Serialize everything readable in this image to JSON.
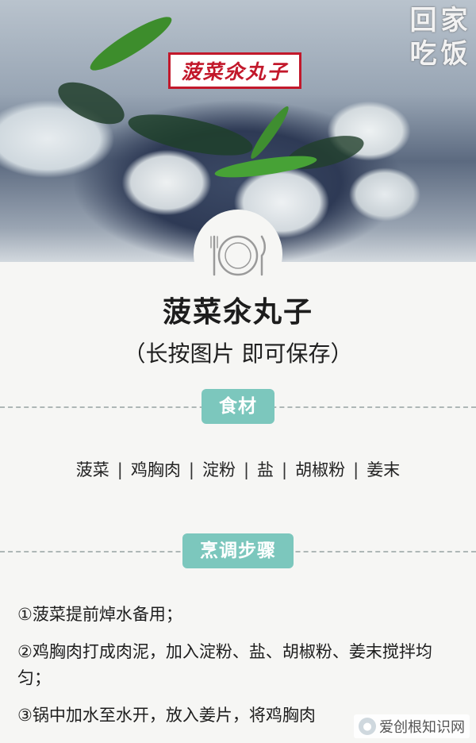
{
  "hero": {
    "dish_label": "菠菜氽丸子",
    "logo_chars": [
      "回",
      "家",
      "吃",
      "饭"
    ]
  },
  "recipe": {
    "title": "菠菜氽丸子",
    "subtitle": "（长按图片 即可保存）",
    "ingredients_heading": "食材",
    "ingredients": [
      "菠菜",
      "鸡胸肉",
      "淀粉",
      "盐",
      "胡椒粉",
      "姜末"
    ],
    "steps_heading": "烹调步骤",
    "steps": [
      "①菠菜提前焯水备用；",
      "②鸡胸肉打成肉泥，加入淀粉、盐、胡椒粉、姜末搅拌均匀；",
      "③锅中加水至水开，放入姜片，将鸡胸肉"
    ]
  },
  "watermark": {
    "text": "爱创根知识网"
  },
  "colors": {
    "accent": "#7cc7bd",
    "label_red": "#c2182b"
  },
  "icons": [
    "plate-cutlery-icon"
  ]
}
